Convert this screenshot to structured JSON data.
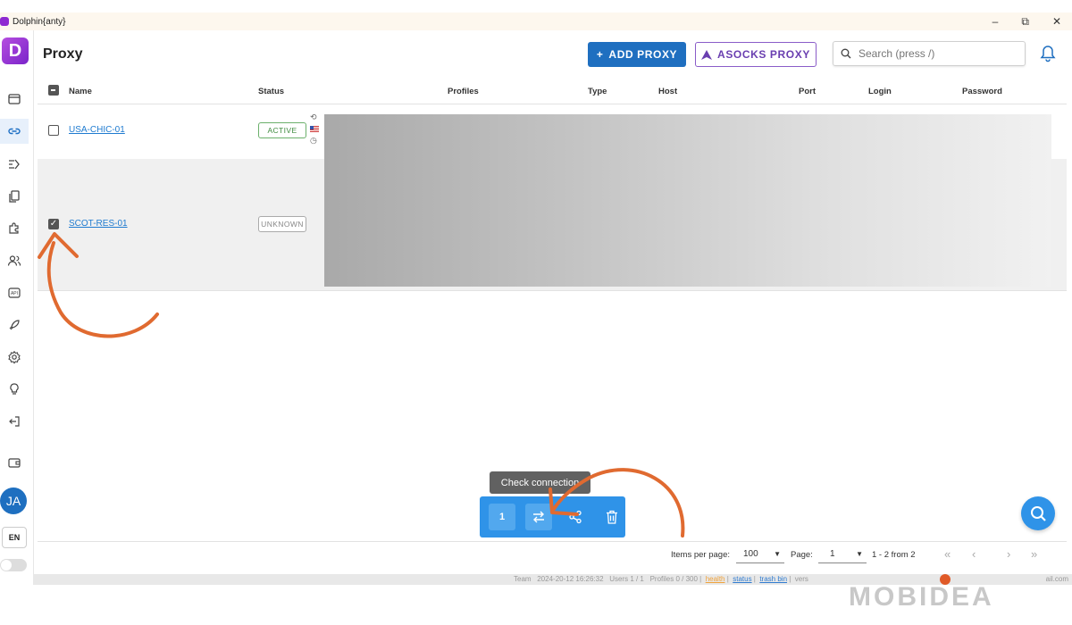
{
  "app": {
    "title": "Dolphin{anty}"
  },
  "window_controls": {
    "minimize": "–",
    "maximize": "⧉",
    "close": "✕"
  },
  "page": {
    "title": "Proxy"
  },
  "toolbar": {
    "add_proxy": "ADD PROXY",
    "asocks_proxy": "ASOCKS PROXY",
    "search_placeholder": "Search (press /)"
  },
  "table": {
    "columns": [
      "Name",
      "Status",
      "Profiles",
      "Type",
      "Host",
      "Port",
      "Login",
      "Password"
    ],
    "rows": [
      {
        "name": "USA-CHIC-01",
        "status": "ACTIVE",
        "selected": false
      },
      {
        "name": "SCOT-RES-01",
        "status": "UNKNOWN",
        "selected": true
      }
    ]
  },
  "bulk_actions": {
    "selected_count": "1",
    "tooltip": "Check connection"
  },
  "pagination": {
    "items_per_page_label": "Items per page:",
    "items_per_page": "100",
    "page_label": "Page:",
    "page": "1",
    "range": "1 - 2 from 2"
  },
  "sidebar": {
    "avatar": "JA",
    "lang": "EN"
  },
  "footer": {
    "team": "Team",
    "datetime": "2024-20-12 16:26:32",
    "users": "Users 1 / 1",
    "profiles": "Profiles 0 / 300",
    "health": "health",
    "status": "status",
    "trash_bin": "trash bin",
    "version": "vers",
    "mail": "ail.com"
  },
  "watermark": "MOBIDEA",
  "colors": {
    "primary": "#1f6fc0",
    "brand": "#8e2ad1",
    "active": "#3e8b3e",
    "annotation": "#e06a30"
  }
}
